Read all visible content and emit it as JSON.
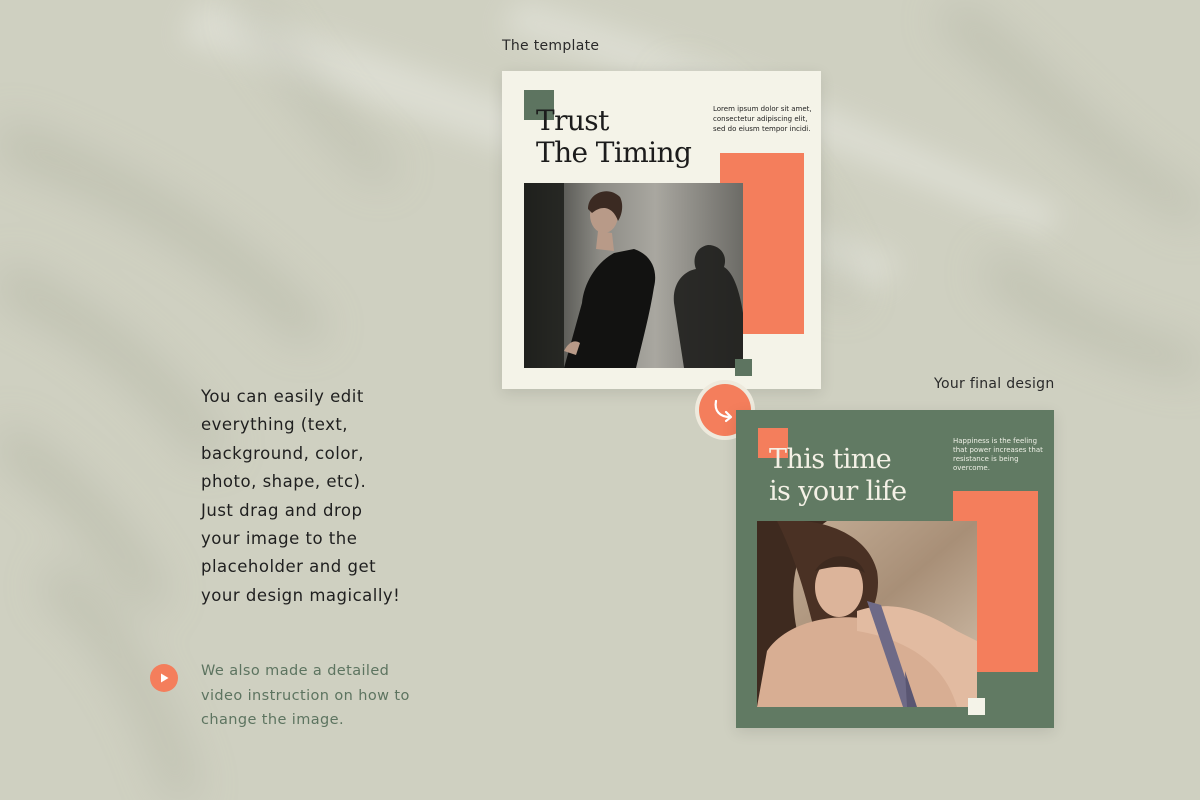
{
  "labels": {
    "template": "The template",
    "final": "Your final design"
  },
  "template_card": {
    "title_line1": "Trust",
    "title_line2": "The Timing",
    "body_line1": "Lorem ipsum dolor sit amet,",
    "body_line2": "consectetur adipiscing elit,",
    "body_line3": "sed do eiusm tempor incidi."
  },
  "final_card": {
    "title_line1": "This time",
    "title_line2": "is your life",
    "body_line1": "Happiness is the feeling",
    "body_line2": "that power increases that",
    "body_line3": "resistance is being",
    "body_line4": "overcome."
  },
  "description": {
    "line1": "You can easily edit",
    "line2": "everything (text,",
    "line3": "background, color,",
    "line4": "photo, shape, etc).",
    "line5": "Just drag and drop",
    "line6": "your image to the",
    "line7": "placeholder and get",
    "line8": "your design magically!"
  },
  "video_note": {
    "line1": "We also made a detailed",
    "line2": "video instruction on how to",
    "line3": "change the image."
  },
  "icons": {
    "arrow": "curved-arrow-icon",
    "play": "play-icon"
  },
  "colors": {
    "background": "#cfd0c1",
    "sage": "#617a63",
    "coral": "#f47e5c",
    "cream": "#f4f3e8"
  }
}
